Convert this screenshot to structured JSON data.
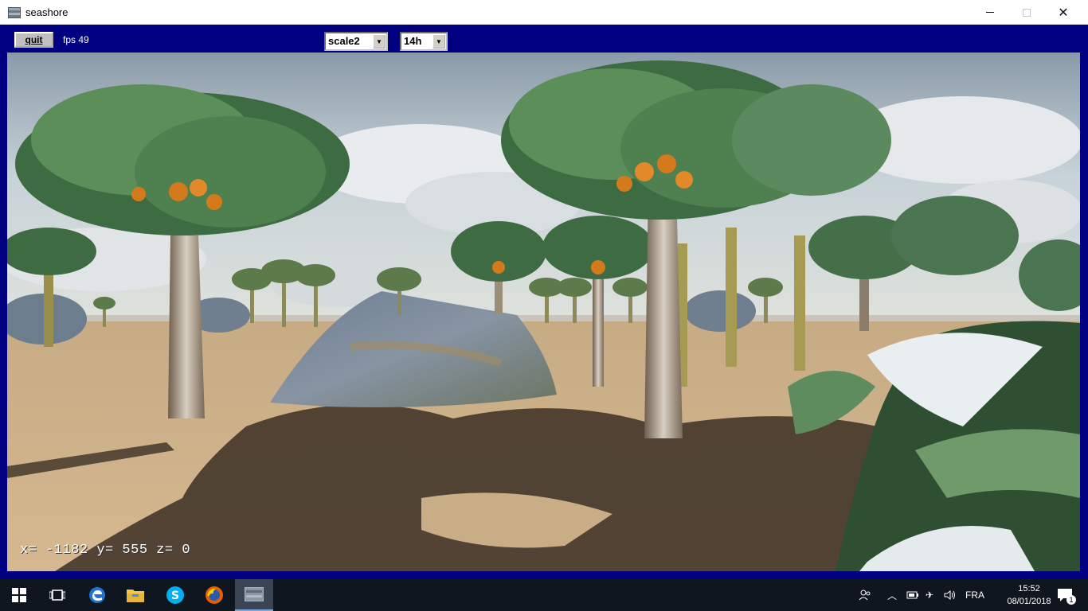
{
  "window": {
    "title": "seashore",
    "minimize_icon": "minimize-icon",
    "maximize_icon": "maximize-icon",
    "close_icon": "close-icon"
  },
  "toolbar": {
    "quit_label": "quit",
    "fps_label": "fps 49",
    "scale_select": {
      "value": "scale2"
    },
    "hour_select": {
      "value": "14h"
    }
  },
  "viewport": {
    "coordinates_label": "x= -1182 y= 555 z= 0"
  },
  "taskbar": {
    "items": [
      "start-icon",
      "task-view-icon",
      "edge-icon",
      "file-explorer-icon",
      "skype-icon",
      "firefox-icon",
      "seashore-app-icon"
    ],
    "tray": {
      "language": "FRA",
      "time": "15:52",
      "date": "08/01/2018",
      "notification_count": "1"
    }
  },
  "colors": {
    "frame": "#000080",
    "taskbar": "#0f1620",
    "sand": "#c8a97e"
  }
}
